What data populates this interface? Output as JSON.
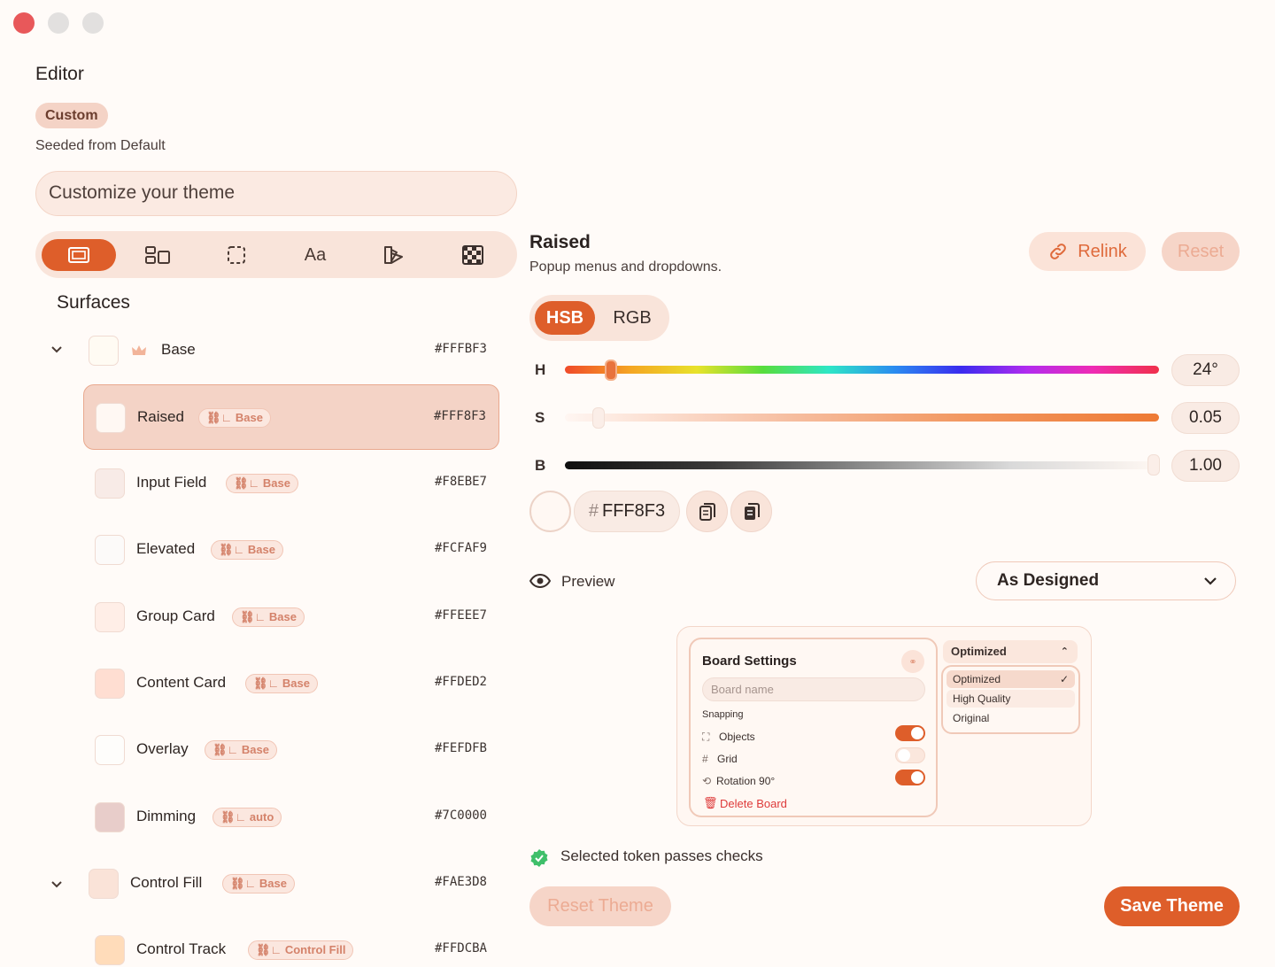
{
  "window": {
    "close_color": "#e8585a",
    "min_color": "#e2e0df",
    "max_color": "#e2e0df"
  },
  "editor": {
    "title": "Editor",
    "badge": "Custom",
    "seeded_text": "Seeded from Default",
    "customize_placeholder": "Customize your theme"
  },
  "tabs": [
    {
      "icon": "window-icon",
      "active": true
    },
    {
      "icon": "layout-icon",
      "active": false
    },
    {
      "icon": "selection-icon",
      "active": false
    },
    {
      "label": "Aa",
      "icon": "typography-icon",
      "active": false
    },
    {
      "icon": "palette-icon",
      "active": false
    },
    {
      "icon": "checker-icon",
      "active": false
    }
  ],
  "surfaces": {
    "section_title": "Surfaces",
    "items": [
      {
        "name": "Base",
        "chip": "",
        "hex": "#FFFBF3",
        "color": "#fffbf3"
      },
      {
        "name": "Raised",
        "chip": "Base",
        "hex": "#FFF8F3",
        "color": "#fff8f3"
      },
      {
        "name": "Input Field",
        "chip": "Base",
        "hex": "#F8EBE7",
        "color": "#f8ebe7"
      },
      {
        "name": "Elevated",
        "chip": "Base",
        "hex": "#FCFAF9",
        "color": "#fcfaf9"
      },
      {
        "name": "Group Card",
        "chip": "Base",
        "hex": "#FFEEE7",
        "color": "#ffeee7"
      },
      {
        "name": "Content Card",
        "chip": "Base",
        "hex": "#FFDED2",
        "color": "#ffded2"
      },
      {
        "name": "Overlay",
        "chip": "Base",
        "hex": "#FEFDFB",
        "color": "#fefdfb"
      },
      {
        "name": "Dimming",
        "chip": "auto",
        "hex": "#7C0000",
        "color": "#e8cdca"
      },
      {
        "name": "Control Fill",
        "chip": "Base",
        "hex": "#FAE3D8",
        "color": "#fae3d8"
      },
      {
        "name": "Control Track",
        "chip": "Control Fill",
        "hex": "#FFDCBA",
        "color": "#ffdcba"
      }
    ]
  },
  "detail": {
    "title": "Raised",
    "subtitle": "Popup menus and dropdowns.",
    "relink_label": "Relink",
    "reset_label": "Reset",
    "mode_hsb": "HSB",
    "mode_rgb": "RGB",
    "h_label": "H",
    "h_value": "24°",
    "h_fraction": 0.08,
    "s_label": "S",
    "s_value": "0.05",
    "s_fraction": 0.05,
    "b_label": "B",
    "b_value": "1.00",
    "b_fraction": 1.0,
    "hex_prefix": "#",
    "hex_value": "FFF8F3",
    "preview_label": "Preview",
    "preview_mode": "As Designed"
  },
  "preview": {
    "card_title": "Board Settings",
    "board_name_placeholder": "Board name",
    "snapping_label": "Snapping",
    "options": [
      {
        "label": "Objects",
        "icon": "frame-icon",
        "on": true
      },
      {
        "label": "Grid",
        "icon": "hash-icon",
        "on": false
      },
      {
        "label": "Rotation 90°",
        "icon": "rotate-icon",
        "on": true
      }
    ],
    "delete_label": "Delete Board",
    "menu_selected": "Optimized",
    "menu_items": [
      "Optimized",
      "High Quality",
      "Original"
    ]
  },
  "status_text": "Selected token passes checks",
  "footer": {
    "reset_theme_label": "Reset Theme",
    "save_label": "Save Theme"
  },
  "colors": {
    "accent": "#de5e2a",
    "accent_soft": "#f9e4da",
    "chip_text": "#d4826a"
  }
}
